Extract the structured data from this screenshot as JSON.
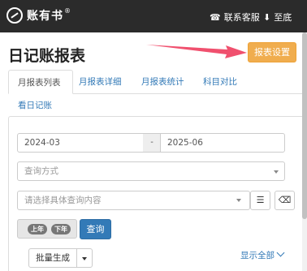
{
  "header": {
    "logo_text": "账有书",
    "logo_mark": "®",
    "contact_label": "联系客服",
    "bottom_label": "至底"
  },
  "page": {
    "title": "日记账报表",
    "report_settings_button": "报表设置"
  },
  "tabs": [
    {
      "label": "月报表列表",
      "active": true
    },
    {
      "label": "月报表详细",
      "active": false
    },
    {
      "label": "月报表统计",
      "active": false
    },
    {
      "label": "科目对比",
      "active": false
    },
    {
      "label": "看日记账",
      "active": false
    }
  ],
  "filters": {
    "date_start": "2024-03",
    "date_separator": "-",
    "date_end": "2025-06",
    "query_method_placeholder": "查询方式",
    "query_content_placeholder": "请选择具体查询内容"
  },
  "actions": {
    "first_half_label": "上年",
    "second_half_label": "下年",
    "query_button": "查询",
    "batch_generate_button": "批量生成",
    "show_all_link": "显示全部"
  },
  "colors": {
    "topbar": "#2b2b2b",
    "accent_orange": "#f0ad4e",
    "primary_blue": "#337ab7",
    "arrow_red": "#f0506e"
  },
  "icons": {
    "contact": "phone-icon",
    "bottom": "download-icon",
    "list": "list-icon",
    "eraser": "eraser-icon"
  }
}
